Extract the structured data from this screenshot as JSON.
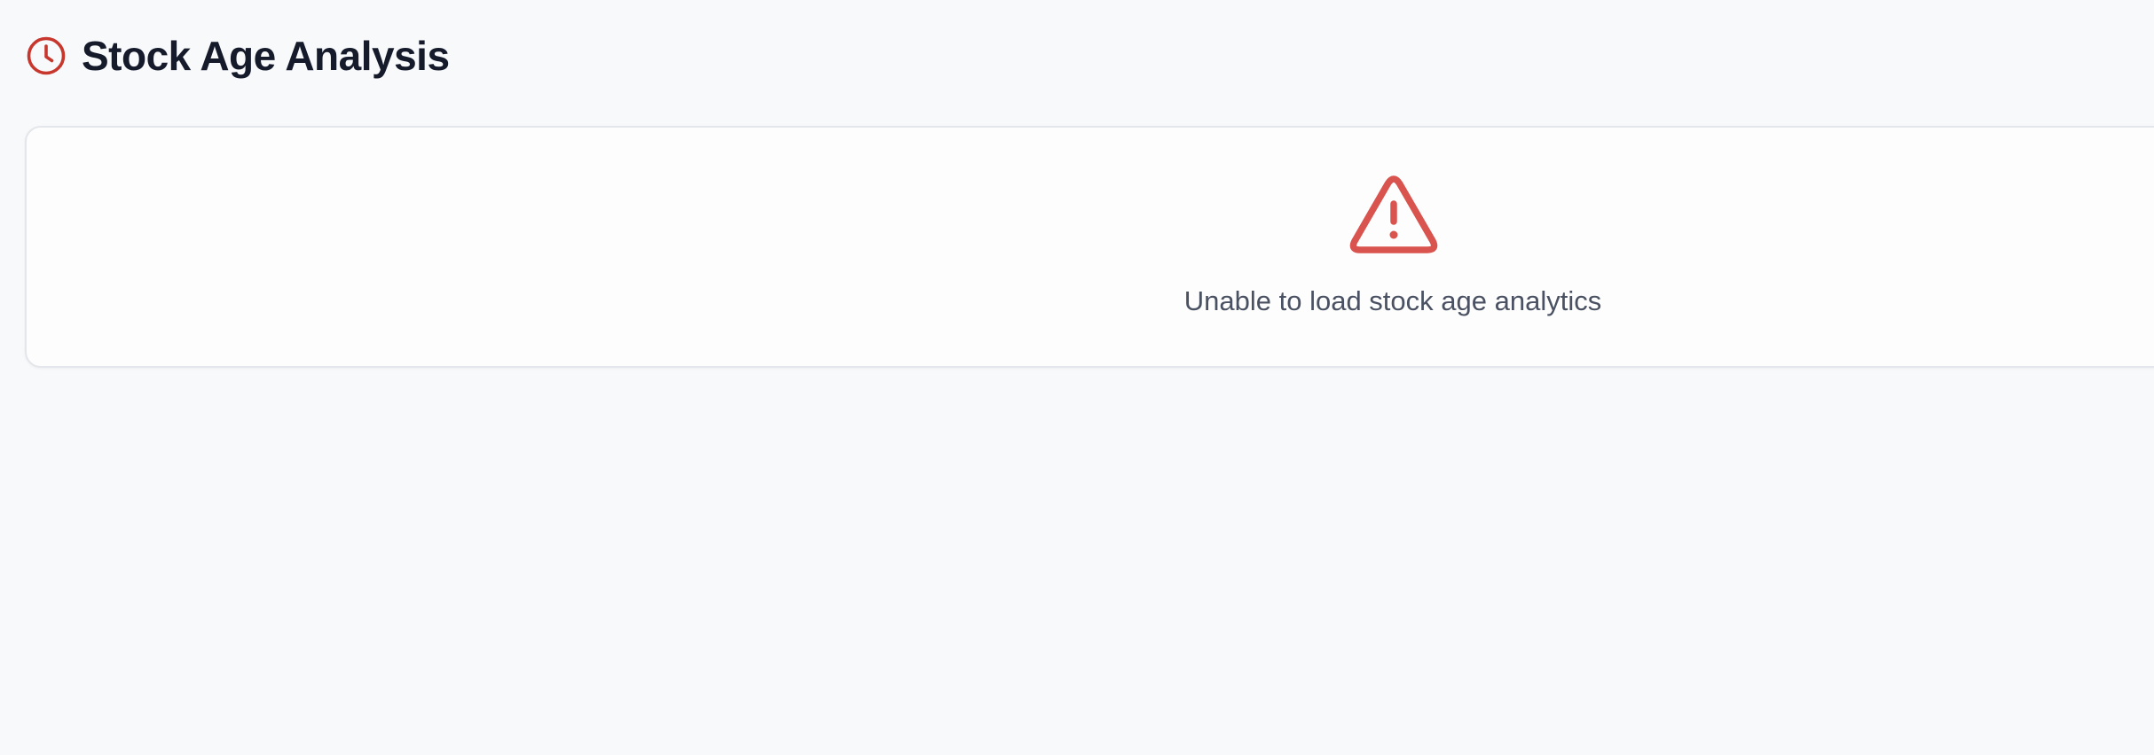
{
  "header": {
    "icon": "clock-icon",
    "title": "Stock Age Analysis"
  },
  "error_card": {
    "icon": "warning-triangle-icon",
    "message": "Unable to load stock age analytics"
  },
  "colors": {
    "background": "#f8f9fb",
    "accent_red": "#c8372d",
    "warning_red": "#d9534f",
    "title_text": "#161b2c",
    "message_text": "#4a5162"
  }
}
